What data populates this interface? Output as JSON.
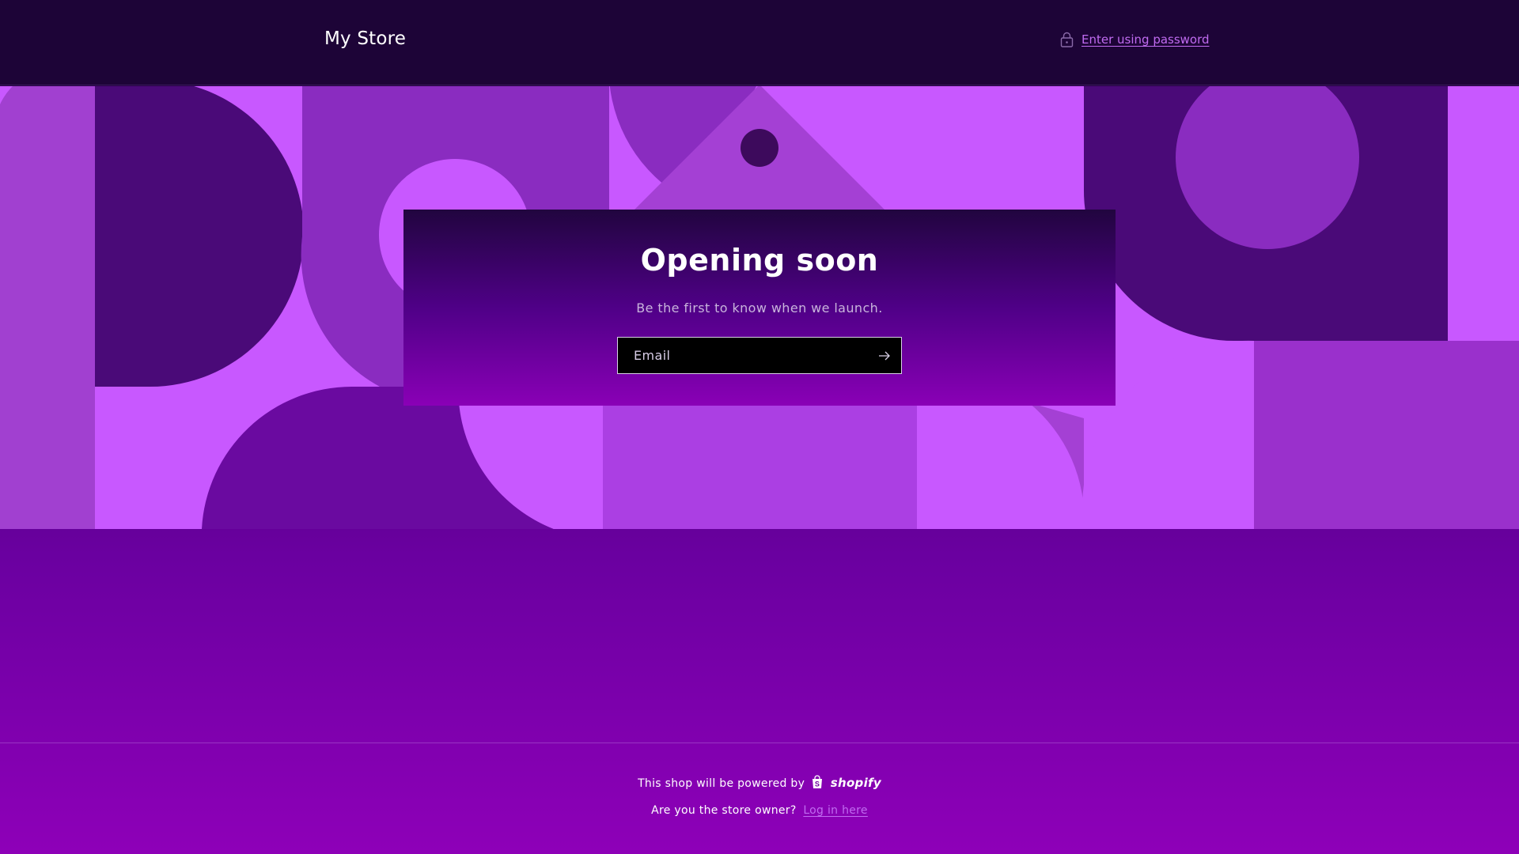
{
  "header": {
    "store_name": "My Store",
    "password_link": "Enter using password",
    "password_icon": "lock-icon"
  },
  "main": {
    "title": "Opening soon",
    "subtitle": "Be the first to know when we launch.",
    "email_placeholder": "Email",
    "submit_icon": "arrow-right-icon"
  },
  "footer": {
    "powered_text": "This shop will be powered by",
    "brand": "shopify",
    "brand_icon": "shopify-bag-icon",
    "owner_text": "Are you the store owner?",
    "login_link": "Log in here"
  },
  "colors": {
    "header_bg": "#1d0437",
    "banner_bg": "#c858ff",
    "accent": "#c06bf0",
    "page_bottom": "#8e00b8"
  }
}
